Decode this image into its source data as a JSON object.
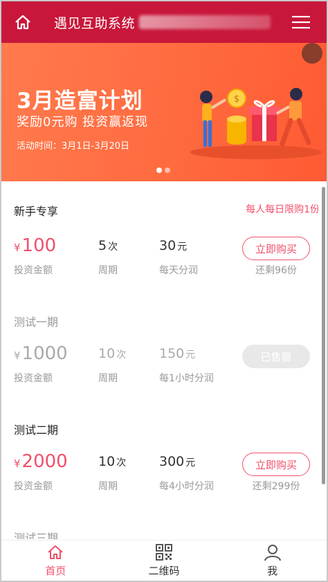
{
  "header": {
    "title": "遇见互助系统"
  },
  "banner": {
    "headline": "3月造富计划",
    "subline": "奖励0元购  投资赢返现",
    "period": "活动时间：3月1日-3月20日"
  },
  "sections": [
    {
      "title": "新手专享",
      "limit": "每人每日限购1份",
      "currency": "¥",
      "amount": "100",
      "amount_label": "投资金额",
      "cycle": "5",
      "cycle_unit": "次",
      "cycle_label": "周期",
      "payout": "30",
      "payout_unit": "元",
      "payout_label": "每天分润",
      "button": "立即购买",
      "remaining": "还剩96份",
      "status": "active"
    },
    {
      "title": "测试一期",
      "currency": "¥",
      "amount": "1000",
      "amount_label": "投资金额",
      "cycle": "10",
      "cycle_unit": "次",
      "cycle_label": "周期",
      "payout": "150",
      "payout_unit": "元",
      "payout_label": "每1小时分润",
      "button": "已售罄",
      "status": "sold"
    },
    {
      "title": "测试二期",
      "currency": "¥",
      "amount": "2000",
      "amount_label": "投资金额",
      "cycle": "10",
      "cycle_unit": "次",
      "cycle_label": "周期",
      "payout": "300",
      "payout_unit": "元",
      "payout_label": "每4小时分润",
      "button": "立即购买",
      "remaining": "还剩299份",
      "status": "active"
    },
    {
      "title": "测试三期"
    }
  ],
  "tabbar": [
    {
      "label": "首页",
      "icon": "home-icon",
      "active": true
    },
    {
      "label": "二维码",
      "icon": "qrcode-icon",
      "active": false
    },
    {
      "label": "我",
      "icon": "user-icon",
      "active": false
    }
  ],
  "colors": {
    "header": "#c8173a",
    "accent": "#f0506b",
    "banner": "#ff6a3f"
  }
}
